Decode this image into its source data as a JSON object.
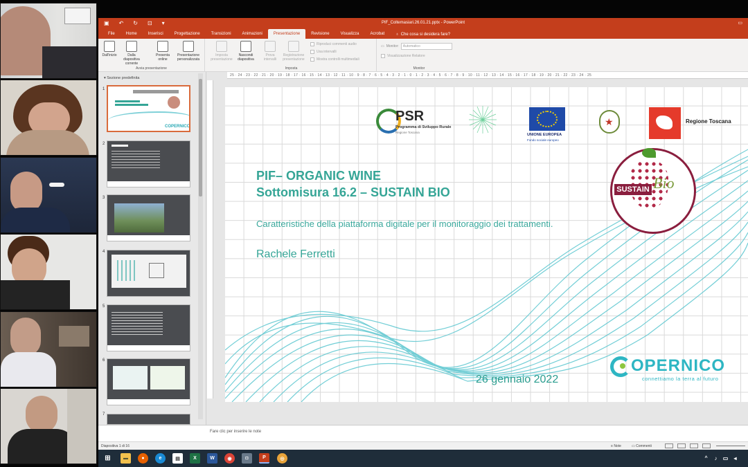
{
  "window": {
    "title": "PIF_Coltemasiari.26.01.21.pptx - PowerPoint"
  },
  "tabs": [
    "File",
    "Home",
    "Inserisci",
    "Progettazione",
    "Transizioni",
    "Animazioni",
    "Presentazione",
    "Revisione",
    "Visualizza",
    "Acrobat"
  ],
  "active_tab": "Presentazione",
  "tell_me": "Che cosa si desidera fare?",
  "ribbon": {
    "avvia": {
      "label": "Avvia presentazione",
      "buttons": [
        "Dall'inizio",
        "Dalla diapositiva corrente",
        "Presenta online",
        "Presentazione personalizzata"
      ]
    },
    "imposta": {
      "label": "Imposta",
      "buttons": [
        "Imposta presentazione",
        "Nascondi diapositiva",
        "Prova intervalli",
        "Registrazione presentazione"
      ],
      "checks": [
        "Riproduci commenti audio",
        "Usa intervalli",
        "Mostra controlli multimediali"
      ]
    },
    "monitor": {
      "label": "Monitor",
      "monitor_label": "Monitor:",
      "monitor_value": "Automatico",
      "presenter_view": "Visualizzazione Relatore"
    }
  },
  "thumbnails": {
    "section": "Sezione predefinita",
    "numbers": [
      "1",
      "2",
      "3",
      "4",
      "5",
      "6",
      "7"
    ]
  },
  "slide": {
    "logos": {
      "psr_big": "PSR",
      "psr_sub": "Programma di Sviluppo Rurale",
      "psr_region": "Regione Toscana",
      "eu_name": "UNIONE EUROPEA",
      "eu_sub": "Fondo sociale europeo",
      "region": "Regione Toscana",
      "sustain": "SUSTAIN",
      "bio": "Bio",
      "copernico": "OPERNICO",
      "copernico_tag": "connettiamo la terra al futuro"
    },
    "title_line1": "PIF– ORGANIC WINE",
    "title_line2": "Sottomisura 16.2 – SUSTAIN BIO",
    "subtitle": "Caratteristiche della piattaforma digitale per il monitoraggio dei trattamenti.",
    "author": "Rachele Ferretti",
    "date": "26 gennaio 2022"
  },
  "notes_placeholder": "Fare clic per inserire le note",
  "status": {
    "slide_counter": "Diapositiva 1 di 16",
    "notes_btn": "Note",
    "comments_btn": "Commenti"
  },
  "colors": {
    "accent": "#c43e1c",
    "teal": "#35a596"
  }
}
